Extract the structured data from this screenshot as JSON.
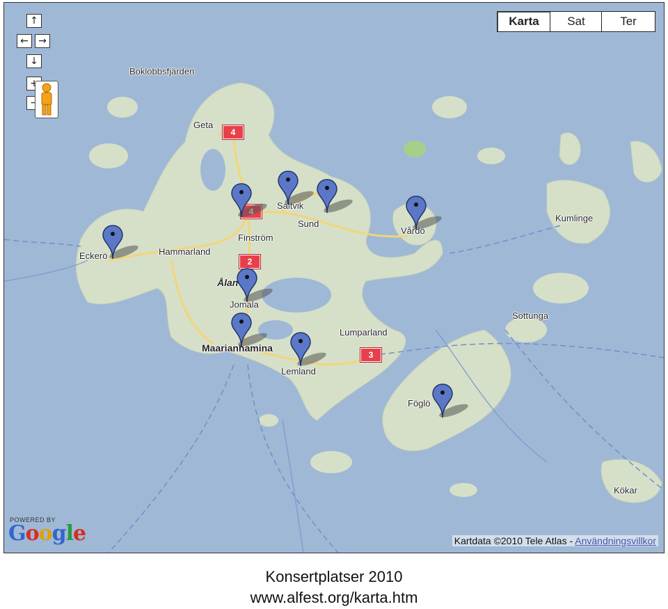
{
  "map": {
    "place_names": {
      "boklobbsfjarden": "Boklobbsfjärden",
      "geta": "Geta",
      "saltvik": "Saltvik",
      "sund": "Sund",
      "finstrom": "Finström",
      "hammarland": "Hammarland",
      "eckero": "Eckerö",
      "aland": "Ålan",
      "jomala": "Jomala",
      "mariehamn": "Maarianhamina",
      "lemland": "Lemland",
      "lumparland": "Lumparland",
      "vardo": "Vårdö",
      "kumlinge": "Kumlinge",
      "sottunga": "Sottunga",
      "foglo": "Föglö",
      "kokar": "Kökar"
    },
    "clusters": [
      {
        "label": "4"
      },
      {
        "label": "4"
      },
      {
        "label": "2"
      },
      {
        "label": "3"
      }
    ],
    "markers": [
      {
        "name": "Eckerö"
      },
      {
        "name": "Finström"
      },
      {
        "name": "Saltvik"
      },
      {
        "name": "Sund"
      },
      {
        "name": "Vårdö"
      },
      {
        "name": "Jomala"
      },
      {
        "name": "Mariehamn"
      },
      {
        "name": "Lemland"
      },
      {
        "name": "Föglö"
      }
    ]
  },
  "controls": {
    "pan_up": "↑",
    "pan_left": "←",
    "pan_right": "→",
    "pan_down": "↓",
    "zoom_in": "+",
    "zoom_out": "−",
    "map_types": [
      "Karta",
      "Sat",
      "Ter"
    ],
    "active_map_type": "Karta"
  },
  "branding": {
    "powered_by": "POWERED BY",
    "logo_letters": [
      "G",
      "o",
      "o",
      "g",
      "l",
      "e"
    ],
    "logo_colors": [
      "#3366cc",
      "#d92d20",
      "#e3a000",
      "#3366cc",
      "#2a9a3a",
      "#d92d20"
    ]
  },
  "attribution": {
    "text": "Kartdata ©2010 Tele Atlas - ",
    "link": "Användningsvillkor"
  },
  "caption": {
    "title": "Konsertplatser 2010",
    "url": "www.alfest.org/karta.htm"
  },
  "colors": {
    "water": "#9fb8d6",
    "land": "#d6e0c8",
    "road": "#f2d57a",
    "marker": "#5b78c8",
    "cluster": "#e8404a"
  },
  "icons": {
    "marker": "map-pin-icon",
    "pegman": "street-view-pegman-icon"
  }
}
